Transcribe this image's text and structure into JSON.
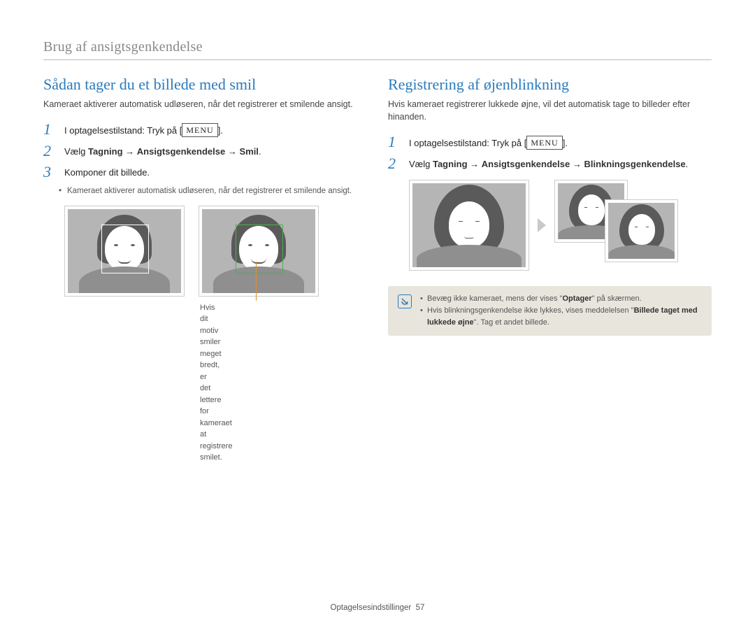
{
  "breadcrumb": "Brug af ansigtsgenkendelse",
  "left": {
    "title": "Sådan tager du et billede med smil",
    "lead": "Kameraet aktiverer automatisk udløseren, når det registrerer et smilende ansigt.",
    "step1_pre": "I optagelsestilstand: Tryk på [",
    "step1_menu": "MENU",
    "step1_post": "].",
    "step2": "Vælg ",
    "step2_b1": "Tagning",
    "step2_arrow": " → ",
    "step2_b2": "Ansigtsgenkendelse",
    "step2_b3": "Smil",
    "step2_end": ".",
    "step3": "Komponer dit billede.",
    "bullet": "Kameraet aktiverer automatisk udløseren, når det registrerer et smilende ansigt.",
    "caption": "Hvis dit motiv smiler meget bredt, er det lettere for kameraet at registrere smilet."
  },
  "right": {
    "title": "Registrering af øjenblinkning",
    "lead": "Hvis kameraet registrerer lukkede øjne, vil det automatisk tage to billeder efter hinanden.",
    "step1_pre": "I optagelsestilstand: Tryk på [",
    "step1_menu": "MENU",
    "step1_post": "].",
    "step2": "Vælg ",
    "step2_b1": "Tagning",
    "step2_arrow": " → ",
    "step2_b2": "Ansigtsgenkendelse",
    "step2_b3": "Blinkningsgenkendelse",
    "step2_end": ".",
    "note1_a": "Bevæg ikke kameraet, mens der vises \"",
    "note1_b": "Optager",
    "note1_c": "\" på skærmen.",
    "note2_a": "Hvis blinkningsgenkendelse ikke lykkes, vises meddelelsen \"",
    "note2_b": "Billede taget med lukkede øjne",
    "note2_c": "\". Tag et andet billede."
  },
  "footer_label": "Optagelsesindstillinger",
  "footer_page": "57"
}
